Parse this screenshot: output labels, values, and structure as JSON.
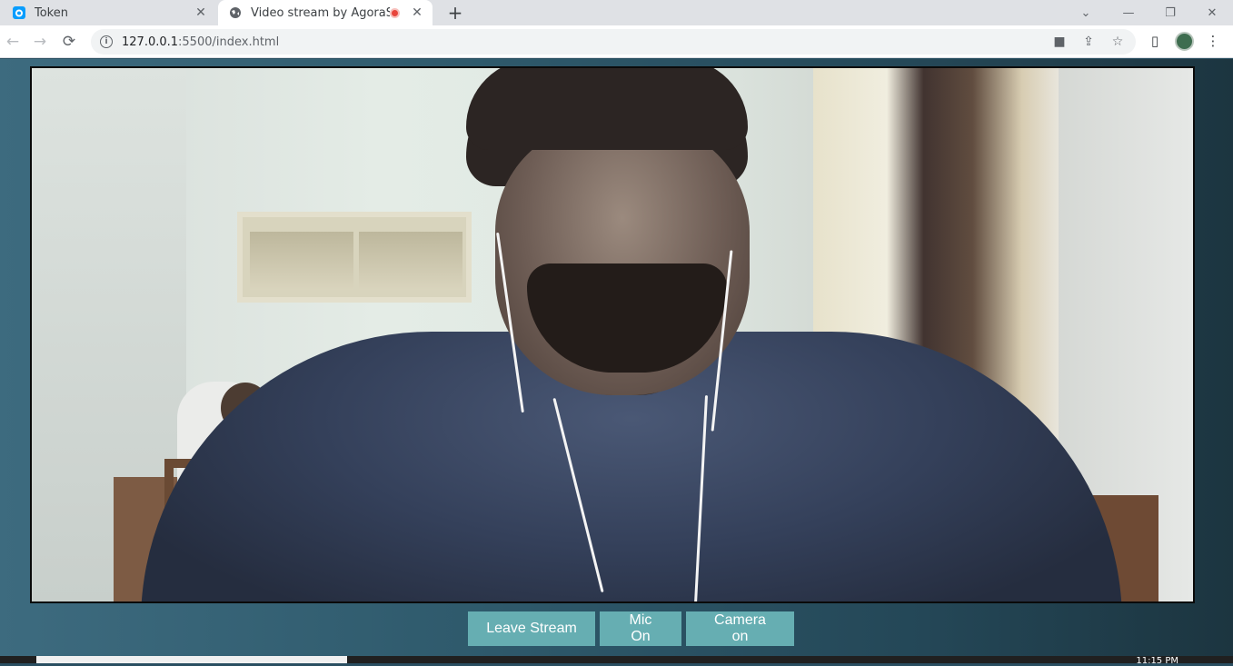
{
  "browser": {
    "tabs": [
      {
        "title": "Token",
        "favicon": "agora-icon",
        "state": "inactive"
      },
      {
        "title": "Video stream by AgoraSdk",
        "favicon": "globe-icon",
        "state": "active",
        "recording": true
      }
    ],
    "new_tab_label": "+",
    "address": {
      "host": "127.0.0.1",
      "path": ":5500/index.html"
    },
    "icons": {
      "back": "←",
      "forward": "→",
      "reload": "⟳",
      "info": "i",
      "camera": "■",
      "share": "⇪",
      "star": "☆",
      "sidepanel": "▯",
      "menu": "⋮",
      "minimize": "—",
      "restore": "❐",
      "close": "✕",
      "tab_close": "✕",
      "tab_search": "⌄"
    }
  },
  "controls": {
    "leave_label": "Leave Stream",
    "mic_label": "Mic On",
    "camera_label": "Camera on"
  },
  "taskbar": {
    "clock": "11:15 PM"
  },
  "colors": {
    "button_bg": "#66aeb2",
    "page_bg": "#2e596b",
    "recording": "#e8453c"
  }
}
